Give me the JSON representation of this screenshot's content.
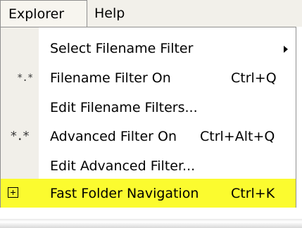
{
  "menubar": {
    "items": [
      {
        "label": "Explorer",
        "mnemonic": "p"
      },
      {
        "label": "Help",
        "mnemonic": "H"
      }
    ]
  },
  "menu": {
    "items": [
      {
        "label": "Select Filename Filter",
        "mnemonic": "S",
        "shortcut": "",
        "icon": "",
        "submenu": true,
        "highlighted": false
      },
      {
        "label": "Filename Filter On",
        "mnemonic": "O",
        "shortcut": "Ctrl+Q",
        "icon": "asterisk-filter-icon",
        "submenu": false,
        "highlighted": false
      },
      {
        "label": "Edit Filename Filters...",
        "mnemonic": "",
        "shortcut": "",
        "icon": "",
        "submenu": false,
        "highlighted": false
      },
      {
        "label": "Advanced Filter On",
        "mnemonic": "A",
        "shortcut": "Ctrl+Alt+Q",
        "icon": "advanced-filter-icon",
        "submenu": false,
        "highlighted": false
      },
      {
        "label": "Edit Advanced Filter...",
        "mnemonic": "E",
        "shortcut": "",
        "icon": "",
        "submenu": false,
        "highlighted": false
      },
      {
        "label": "Fast Folder Navigation",
        "mnemonic": "v",
        "shortcut": "Ctrl+K",
        "icon": "plus-box-icon",
        "submenu": false,
        "highlighted": true
      }
    ]
  },
  "colors": {
    "menubar_background": "#f2f0ea",
    "icon_strip": "#f1efe9",
    "highlight": "#fbfb2f",
    "border": "#8f8f8f"
  },
  "icons": {
    "filter_glyph": "*.*",
    "advanced_glyph": "*.*"
  }
}
